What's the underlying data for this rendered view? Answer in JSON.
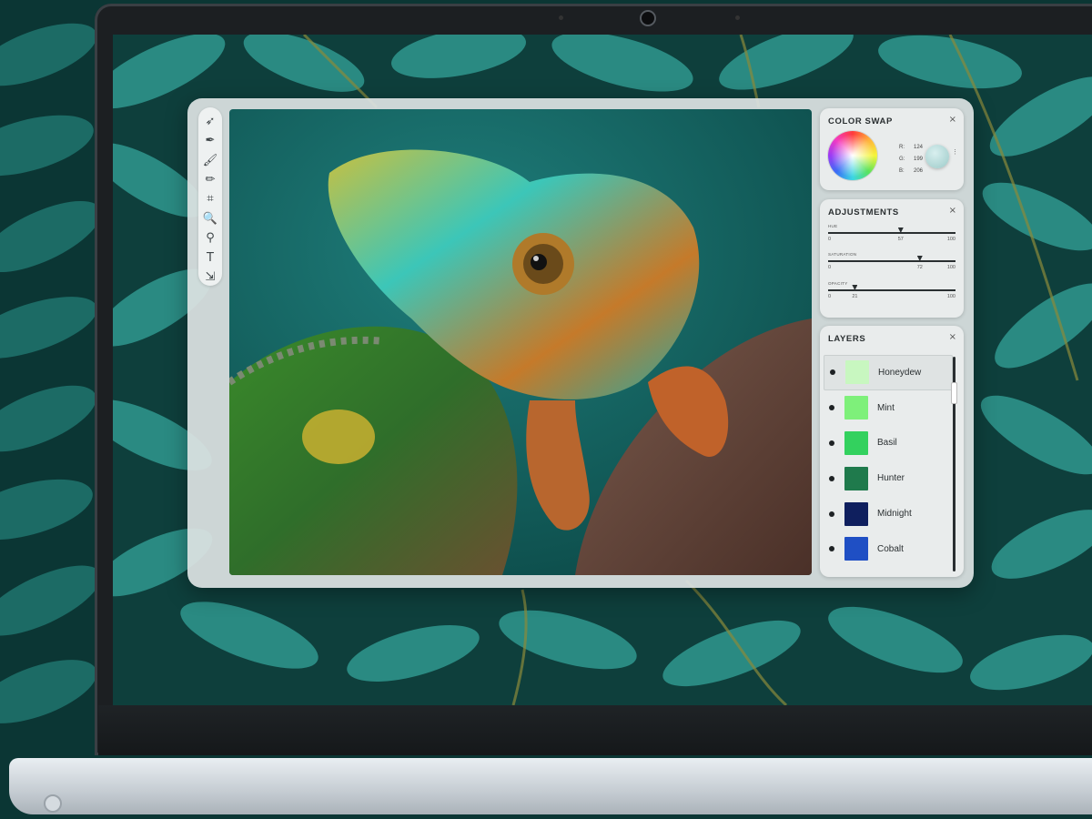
{
  "toolbar": {
    "tools": [
      {
        "icon": "arrow-pointer-icon",
        "glyph": "➶"
      },
      {
        "icon": "pen-tool-icon",
        "glyph": "✒"
      },
      {
        "icon": "brush-icon",
        "glyph": "🖌"
      },
      {
        "icon": "pencil-icon",
        "glyph": "✏"
      },
      {
        "icon": "crop-icon",
        "glyph": "⌗"
      },
      {
        "icon": "zoom-icon",
        "glyph": "🔍"
      },
      {
        "icon": "eyedropper-icon",
        "glyph": "⚲"
      },
      {
        "icon": "text-tool-icon",
        "glyph": "T"
      },
      {
        "icon": "more-tools-icon",
        "glyph": "⇲"
      }
    ]
  },
  "color_swap": {
    "title": "COLOR SWAP",
    "close": "×",
    "r_label": "R:",
    "r_value": "124",
    "g_label": "G:",
    "g_value": "199",
    "b_label": "B:",
    "b_value": "206",
    "more": "⋮"
  },
  "adjustments": {
    "title": "ADJUSTMENTS",
    "close": "×",
    "sliders": [
      {
        "label": "HUE",
        "min": "0",
        "max": "100",
        "value": "57",
        "fraction": 0.57
      },
      {
        "label": "SATURATION",
        "min": "0",
        "max": "100",
        "value": "72",
        "fraction": 0.72
      },
      {
        "label": "OPACITY",
        "min": "0",
        "max": "100",
        "value": "21",
        "fraction": 0.21
      }
    ]
  },
  "layers": {
    "title": "LAYERS",
    "close": "×",
    "items": [
      {
        "name": "Honeydew",
        "color": "#c8f7c0",
        "active": true
      },
      {
        "name": "Mint",
        "color": "#7ef07a",
        "active": false
      },
      {
        "name": "Basil",
        "color": "#33d15e",
        "active": false
      },
      {
        "name": "Hunter",
        "color": "#1f7a4c",
        "active": false
      },
      {
        "name": "Midnight",
        "color": "#0f1f5e",
        "active": false
      },
      {
        "name": "Cobalt",
        "color": "#1f4fc4",
        "active": false
      }
    ]
  }
}
